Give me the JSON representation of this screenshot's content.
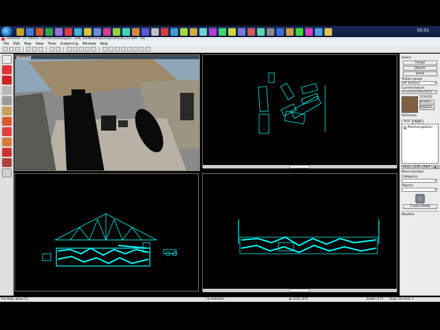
{
  "taskbar": {
    "clock": "05:01",
    "icon_colors": [
      "#c9a227",
      "#3e7bd6",
      "#d6552e",
      "#2fa84a",
      "#9c6fd6",
      "#e23b3b",
      "#3fb3d6",
      "#d6c43e",
      "#6b8fd6",
      "#d63e8f",
      "#8fd63e",
      "#3ed6b3",
      "#d6853e",
      "#5a5ad6",
      "#c0c0c0",
      "#d63e3e",
      "#3e9bd6",
      "#a8d63e",
      "#d6a83e",
      "#6bd6d6",
      "#b33ed6",
      "#3ed670",
      "#d6d63e",
      "#7a7ad6",
      "#d65a5a",
      "#5ad6a8",
      "#8a8a8a",
      "#3e6bd6",
      "#d69a3e",
      "#3ed63e",
      "#d63ec4",
      "#4fa0e0",
      "#e0c44f"
    ]
  },
  "window": {
    "title": "Hammer - [C:\\Valve\\...\\Steam\\steamapps\\...\\sdk_content\\mapsrc\\warehouse_02.vmf - 3d]"
  },
  "menu": [
    "File",
    "Edit",
    "Map",
    "View",
    "Tools",
    "Instancing",
    "Window",
    "Help"
  ],
  "viewports": {
    "camera_label": "camera",
    "top_label": "",
    "front_label": "",
    "side_label": ""
  },
  "right_panel": {
    "select_label": "Select:",
    "groups_button": "Groups",
    "objects_button": "Objects",
    "solids_button": "Solids",
    "texture_group_label": "Texture group:",
    "texture_group_value": "All Textures",
    "current_texture_label": "Current texture:",
    "current_texture_value": "brick/brickfloor001a",
    "texture_size": "512x512",
    "browse_button": "Browse...",
    "replace_button": "Replace...",
    "visgroups_label": "VisGroups:",
    "tab_user": "User",
    "tab_auto": "Auto",
    "visgroup_item": "MainGarageDoor",
    "show_button": "Show",
    "edit_button": "Edit",
    "mark_button": "Mark",
    "move_selected_label": "Move selected:",
    "categories_label": "Categories:",
    "objects_label": "Objects:",
    "create_prefab_button": "Create Prefab",
    "manifest_label": "Manifest"
  },
  "statusbar": {
    "help": "For Help, press F1",
    "selection": "no selection.",
    "coords": "@-1312, 672",
    "zoom": "Zoom: 0.17",
    "snap": "Snap: On Grid: 1"
  },
  "colors": {
    "wireframe": "#00ffff",
    "background": "#000000"
  }
}
